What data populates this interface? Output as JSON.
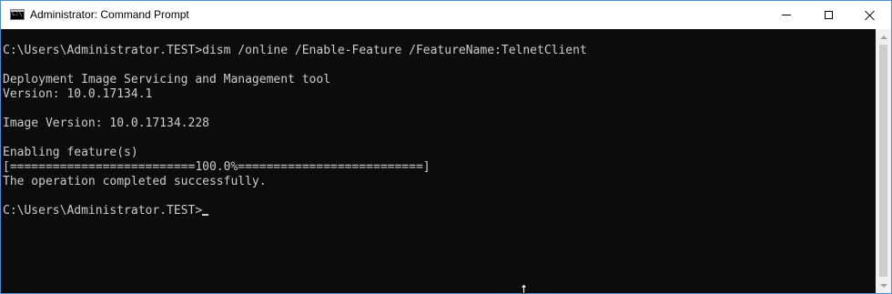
{
  "window": {
    "title": "Administrator: Command Prompt",
    "icon": "cmd-icon",
    "icon_glyph": "C:\\",
    "buttons": {
      "minimize": "minimize-icon",
      "maximize": "maximize-icon",
      "close": "close-icon"
    }
  },
  "console": {
    "background": "#0c0c0c",
    "foreground": "#cccccc",
    "lines": [
      "C:\\Users\\Administrator.TEST>dism /online /Enable-Feature /FeatureName:TelnetClient",
      "",
      "Deployment Image Servicing and Management tool",
      "Version: 10.0.17134.1",
      "",
      "Image Version: 10.0.17134.228",
      "",
      "Enabling feature(s)",
      "[==========================100.0%==========================]",
      "The operation completed successfully.",
      "",
      "C:\\Users\\Administrator.TEST>"
    ],
    "progress_percent": 100.0
  },
  "scrollbar": {
    "up_icon": "scroll-up-arrow-icon",
    "down_icon": "scroll-down-arrow-icon"
  },
  "pointer": "mouse-pointer-icon"
}
